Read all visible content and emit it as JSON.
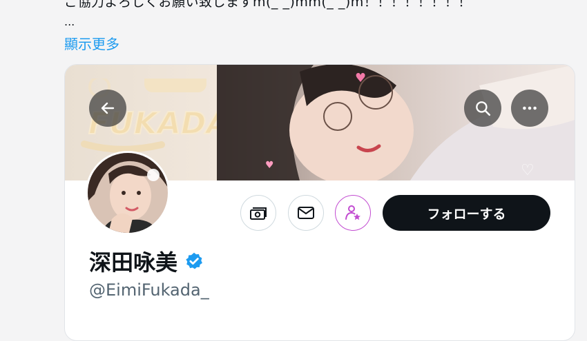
{
  "post": {
    "text_line": "ご協力よろしくお願い致しますm(_ _)mm(_ _)m！！！！！！！！",
    "ellipsis": "...",
    "show_more": "顯示更多"
  },
  "profile_card": {
    "banner_logo_text": "FUKADA",
    "display_name": "深田咏美",
    "handle": "@EimiFukada_",
    "follow_label": "フォローする",
    "verified": true
  },
  "colors": {
    "accent_blue": "#1d9bf0",
    "follow_bg": "#0f1419",
    "subscribe_purple": "#c24bd1",
    "verified_blue": "#1d9bf0"
  }
}
